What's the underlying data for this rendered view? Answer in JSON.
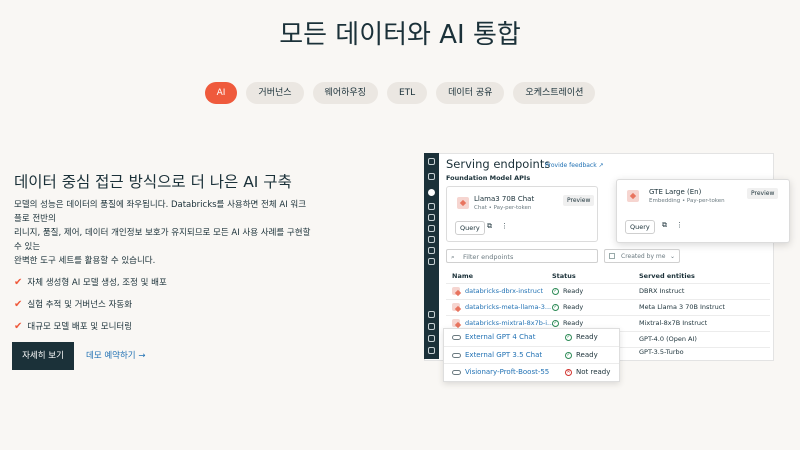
{
  "title": "모든 데이터와 AI 통합",
  "tabs": [
    {
      "label": "AI",
      "active": true
    },
    {
      "label": "거버넌스",
      "active": false
    },
    {
      "label": "웨어하우징",
      "active": false
    },
    {
      "label": "ETL",
      "active": false
    },
    {
      "label": "데이터 공유",
      "active": false
    },
    {
      "label": "오케스트레이션",
      "active": false
    }
  ],
  "section": {
    "heading": "데이터 중심 접근 방식으로 더 나은 AI 구축",
    "description_lines": [
      "모델의 성능은 데이터의 품질에 좌우됩니다. Databricks를 사용하면 전체 AI 워크",
      "플로 전반의",
      "리니지, 품질, 제어, 데이터 개인정보 보호가 유지되므로 모든 AI 사용 사례를 구현할",
      "수 있는",
      "완벽한 도구 세트를 활용할 수 있습니다."
    ],
    "features": [
      "자체 생성형 AI 모델 생성, 조정 및 배포",
      "실험 추적 및 거버넌스 자동화",
      "대규모 모델 배포 및 모니터링"
    ],
    "cta_primary": "자세히 보기",
    "cta_link": "데모 예약하기 →"
  },
  "mock": {
    "title": "Serving endpoints",
    "feedback": "Provide feedback",
    "foundation_label": "Foundation Model APIs",
    "card1": {
      "name": "Llama3 70B Chat",
      "sub": "Chat • Pay-per-token",
      "badge": "Preview",
      "query": "Query"
    },
    "card2": {
      "name": "GTE Large (En)",
      "sub": "Embedding • Pay-per-token",
      "badge": "Preview",
      "query": "Query"
    },
    "filter_placeholder": "Filter endpoints",
    "created_by": "Created by me",
    "columns": [
      "Name",
      "Status",
      "Served entities"
    ],
    "rows": [
      {
        "name": "databricks-dbrx-instruct",
        "status": "Ready",
        "entity": "DBRX Instruct"
      },
      {
        "name": "databricks-meta-llama-3...",
        "status": "Ready",
        "entity": "Meta Llama 3 70B Instruct"
      },
      {
        "name": "databricks-mixtral-8x7b-i...",
        "status": "Ready",
        "entity": "Mixtral-8x7B Instruct"
      },
      {
        "name": "",
        "status": "",
        "entity": "GPT-4.0 (Open AI)"
      },
      {
        "name": "",
        "status": "",
        "entity": "GPT-3.5-Turbo"
      }
    ],
    "external": [
      {
        "name": "External GPT 4 Chat",
        "status": "Ready",
        "ok": true
      },
      {
        "name": "External GPT 3.5 Chat",
        "status": "Ready",
        "ok": true
      },
      {
        "name": "Visionary-Proft-Boost-55",
        "status": "Not ready",
        "ok": false
      }
    ]
  }
}
